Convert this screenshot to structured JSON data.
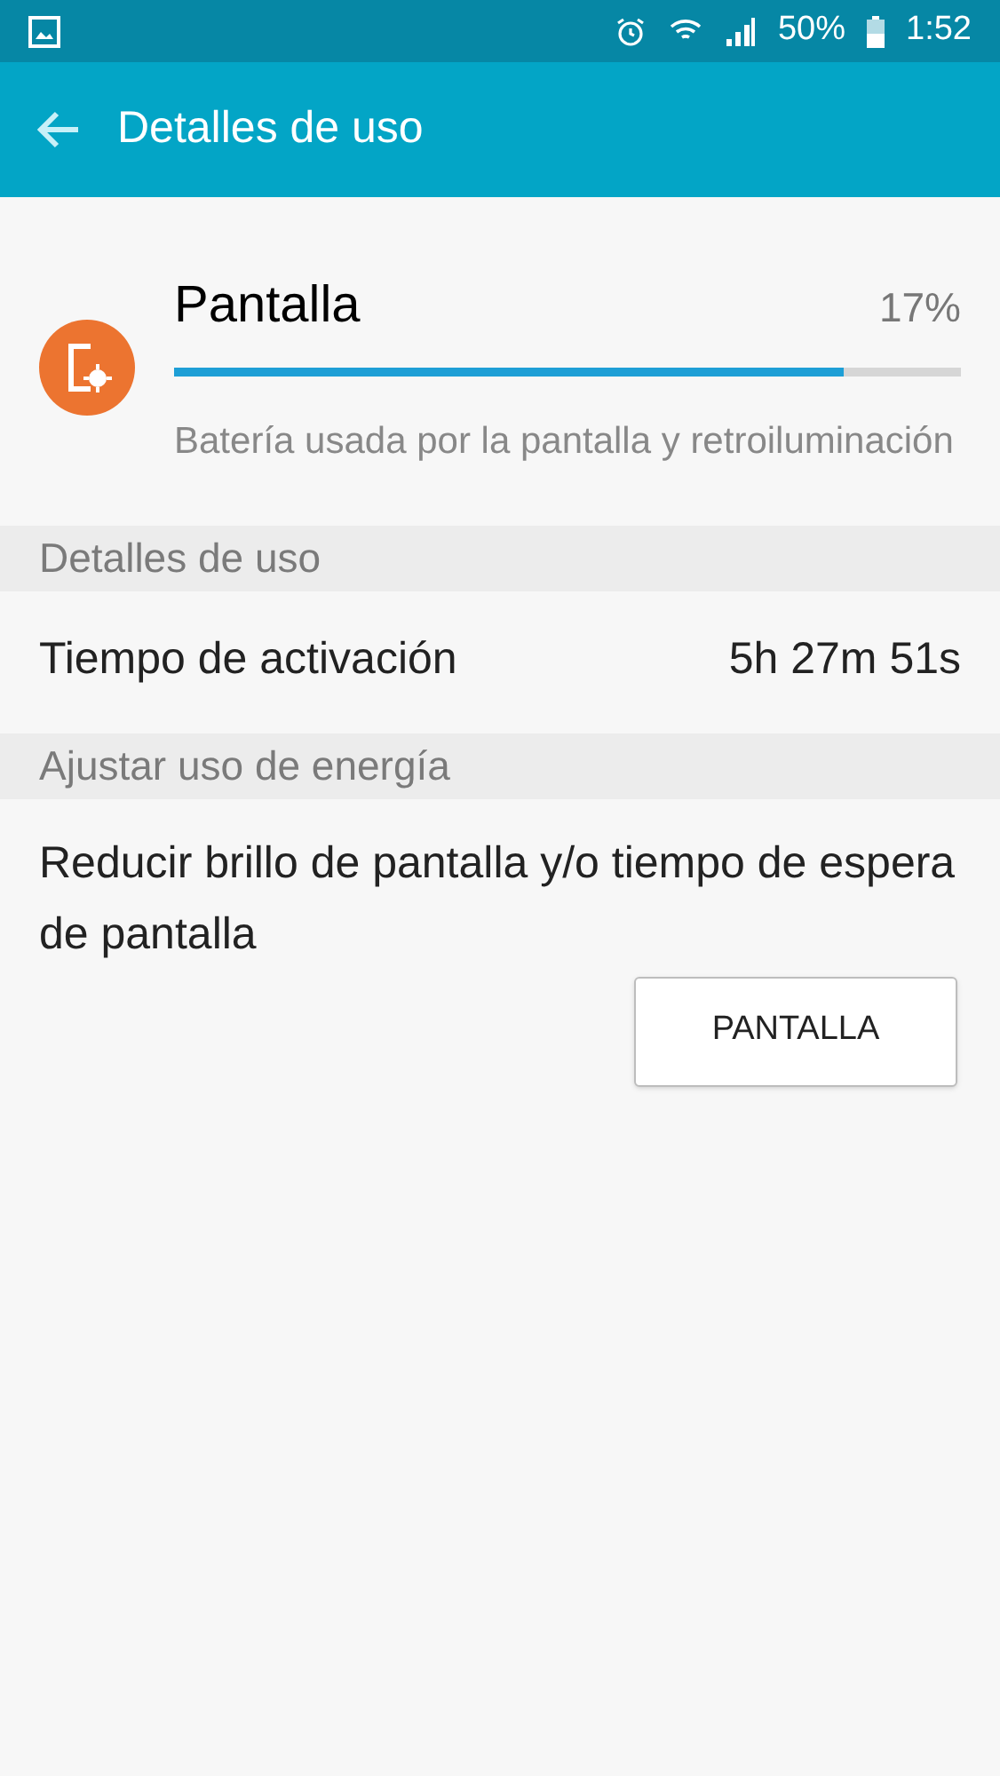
{
  "status_bar": {
    "battery": "50%",
    "time": "1:52"
  },
  "app_bar": {
    "title": "Detalles de uso"
  },
  "usage": {
    "name": "Pantalla",
    "percent": "17%",
    "level": 0.85,
    "description": "Batería usada por la pantalla y retroiluminación"
  },
  "sections": [
    {
      "title": "Detalles de uso",
      "kind": "detail",
      "label": "Tiempo de activación",
      "value": "5h 27m 51s"
    },
    {
      "title": "Ajustar uso de energía",
      "kind": "action",
      "text": "Reducir brillo de pantalla y/o tiempo de espera de pantalla",
      "button": "PANTALLA"
    }
  ]
}
